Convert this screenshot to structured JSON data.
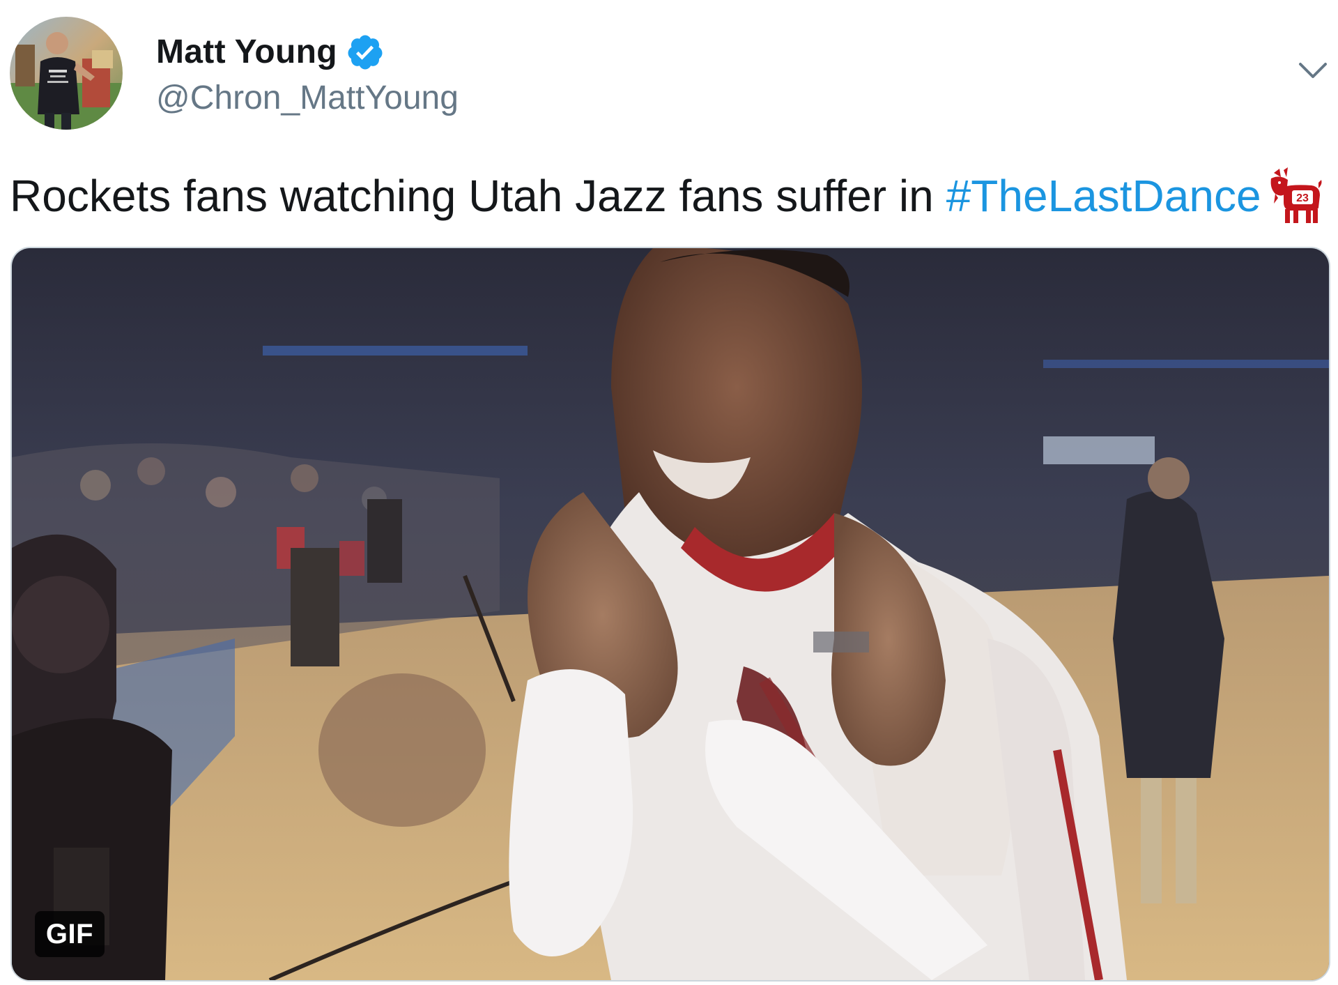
{
  "author": {
    "display_name": "Matt Young",
    "handle": "@Chron_MattYoung",
    "verified": true,
    "avatar_shirt_text": "HOUSTON"
  },
  "tweet": {
    "text": "Rockets fans watching Utah Jazz fans suffer in",
    "hashtag": "#TheLastDance",
    "emoji": "goat-23-icon",
    "emoji_number": "23"
  },
  "media": {
    "type": "gif",
    "badge_label": "GIF"
  },
  "icons": {
    "verified": "verified-badge-icon",
    "menu": "chevron-down-icon"
  },
  "colors": {
    "hashtag": "#1b95e0",
    "handle": "#657786",
    "text": "#14171a",
    "verified": "#1da1f2"
  }
}
